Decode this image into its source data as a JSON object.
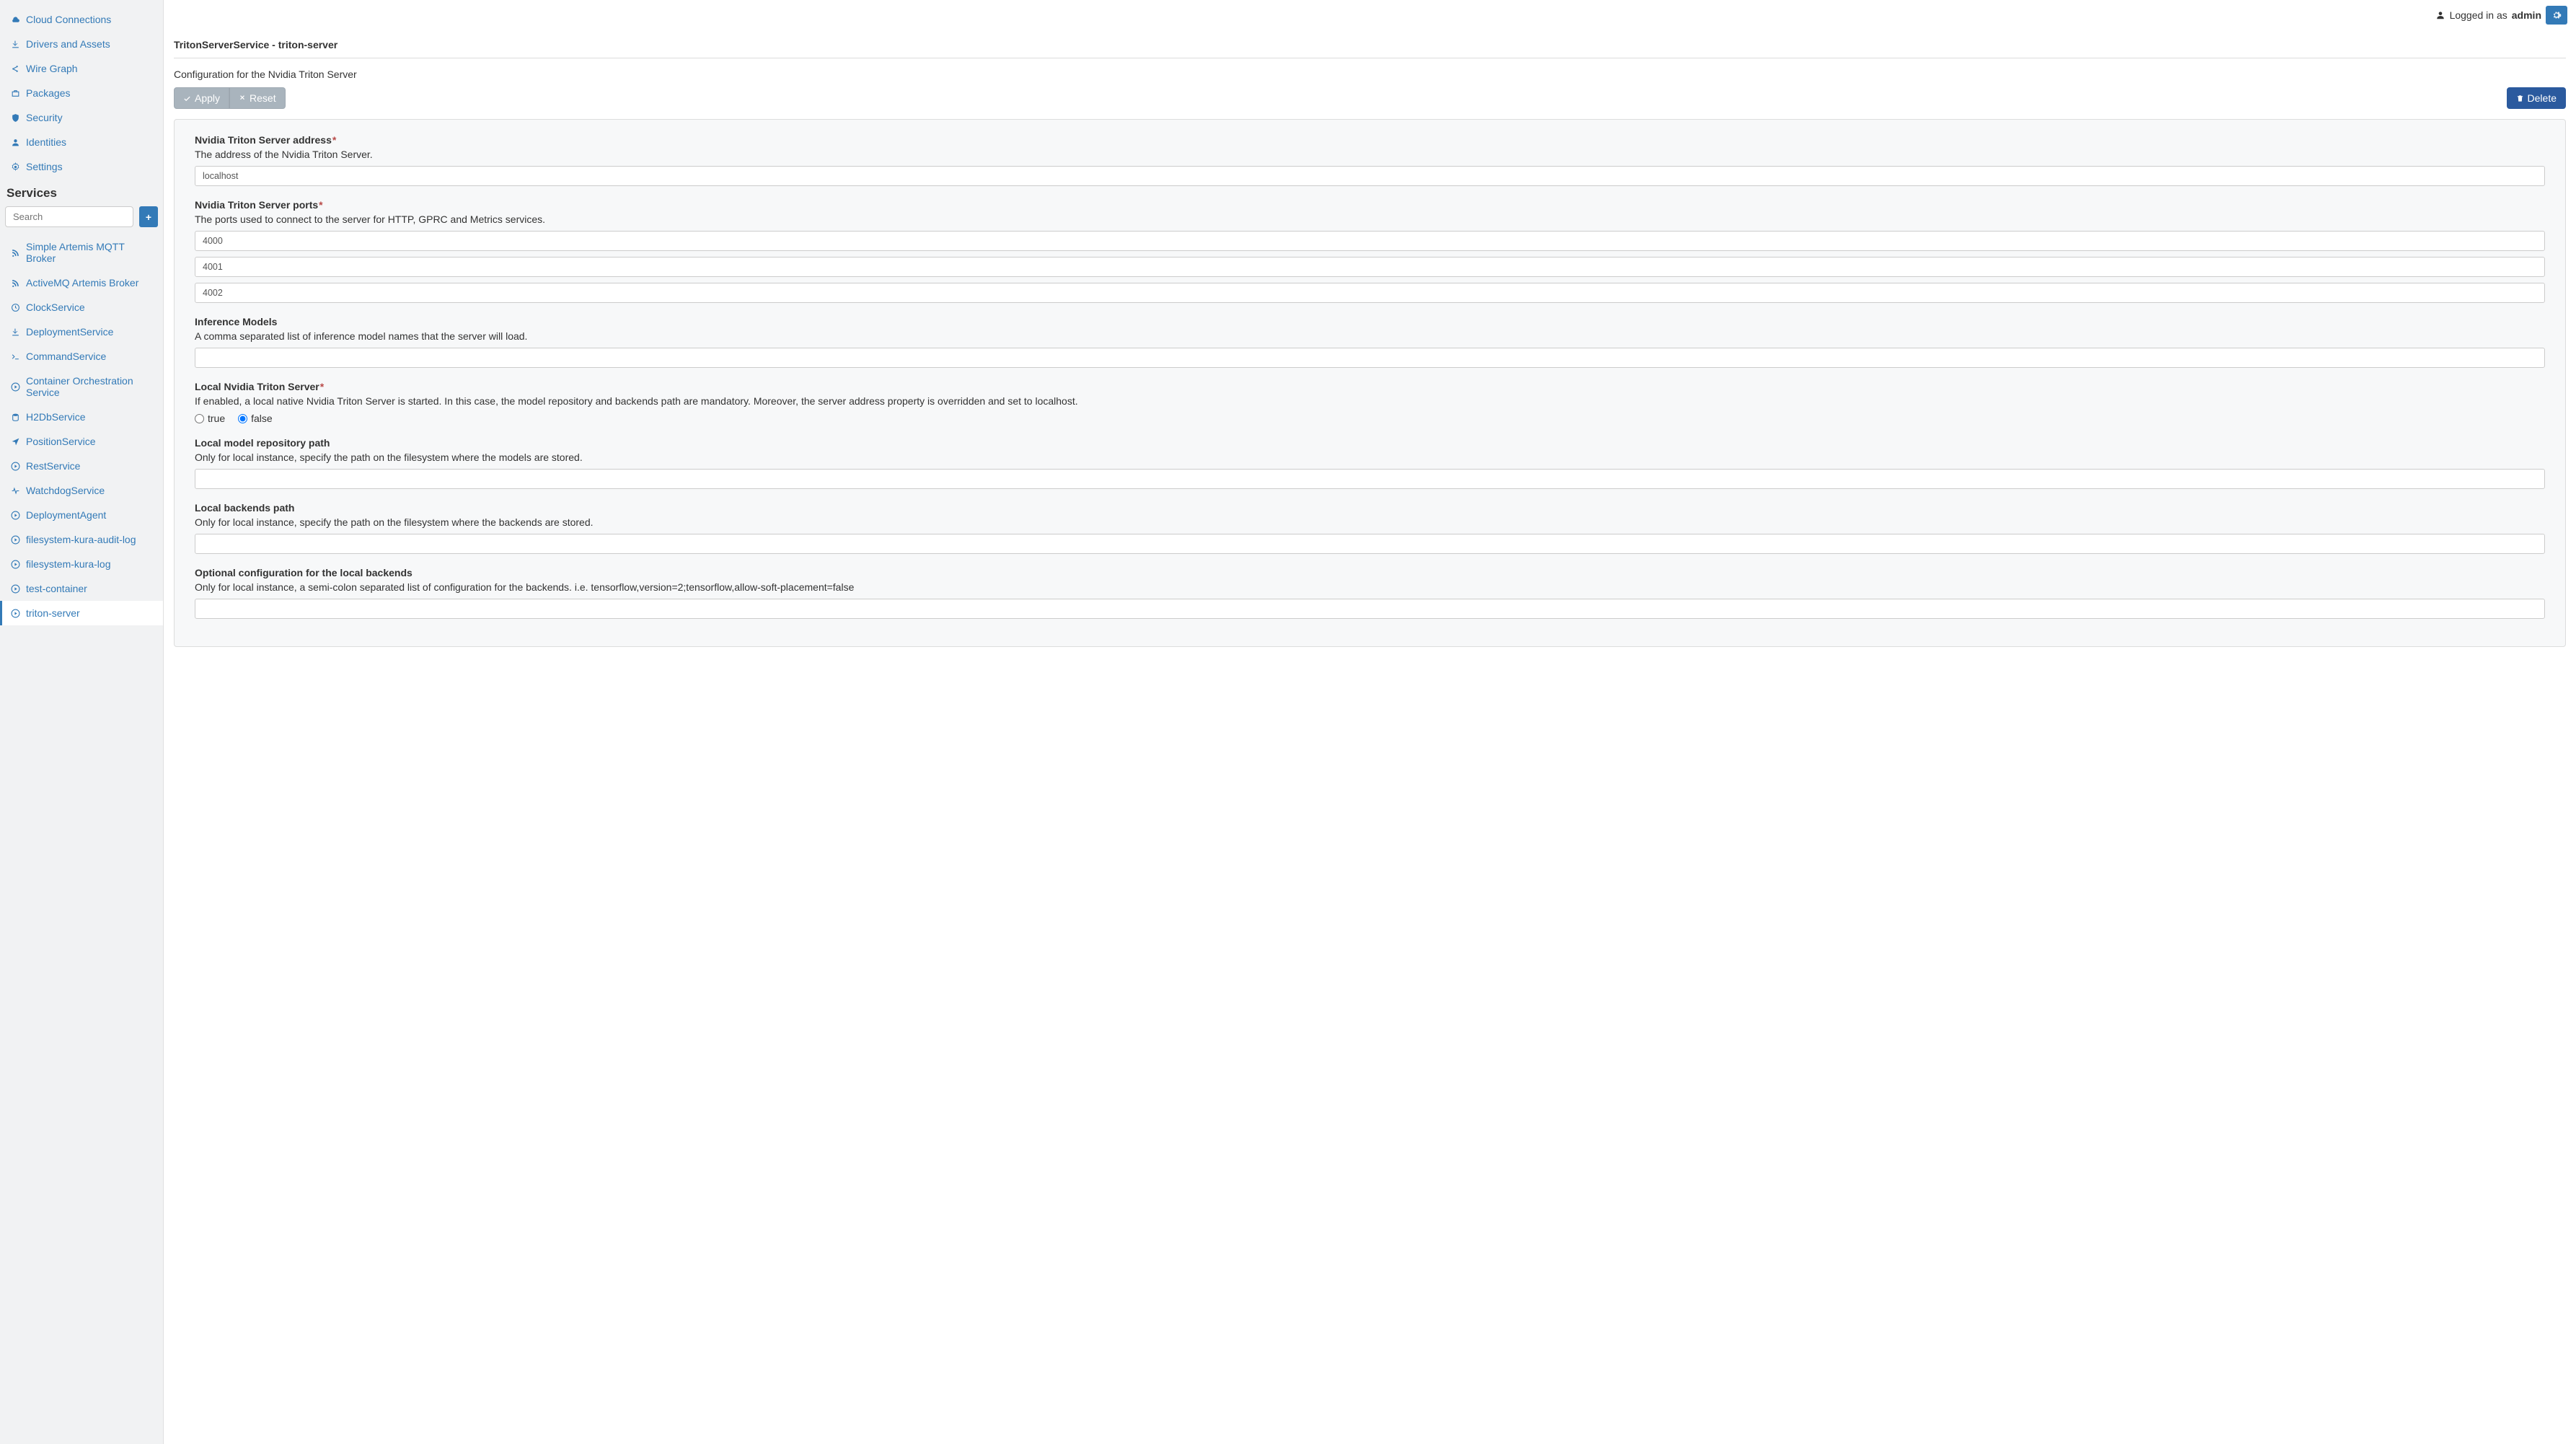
{
  "sidebar": {
    "top": [
      {
        "icon": "cloud",
        "label": "Cloud Connections"
      },
      {
        "icon": "download",
        "label": "Drivers and Assets"
      },
      {
        "icon": "share",
        "label": "Wire Graph"
      },
      {
        "icon": "briefcase",
        "label": "Packages"
      },
      {
        "icon": "shield",
        "label": "Security"
      },
      {
        "icon": "user",
        "label": "Identities"
      },
      {
        "icon": "gear",
        "label": "Settings"
      }
    ],
    "section_heading": "Services",
    "search_placeholder": "Search",
    "services": [
      {
        "icon": "rss",
        "label": "Simple Artemis MQTT Broker"
      },
      {
        "icon": "rss",
        "label": "ActiveMQ Artemis Broker"
      },
      {
        "icon": "clock",
        "label": "ClockService"
      },
      {
        "icon": "download",
        "label": "DeploymentService"
      },
      {
        "icon": "terminal",
        "label": "CommandService"
      },
      {
        "icon": "play",
        "label": "Container Orchestration Service"
      },
      {
        "icon": "db",
        "label": "H2DbService"
      },
      {
        "icon": "location",
        "label": "PositionService"
      },
      {
        "icon": "play",
        "label": "RestService"
      },
      {
        "icon": "heartbeat",
        "label": "WatchdogService"
      },
      {
        "icon": "play",
        "label": "DeploymentAgent"
      },
      {
        "icon": "play",
        "label": "filesystem-kura-audit-log"
      },
      {
        "icon": "play",
        "label": "filesystem-kura-log"
      },
      {
        "icon": "play",
        "label": "test-container"
      },
      {
        "icon": "play",
        "label": "triton-server",
        "active": true
      }
    ]
  },
  "topbar": {
    "logged_in_label": "Logged in as",
    "username": "admin"
  },
  "page": {
    "title": "TritonServerService - triton-server",
    "description": "Configuration for the Nvidia Triton Server",
    "apply_label": "Apply",
    "reset_label": "Reset",
    "delete_label": "Delete"
  },
  "form": {
    "address": {
      "label": "Nvidia Triton Server address",
      "required": true,
      "help": "The address of the Nvidia Triton Server.",
      "value": "localhost"
    },
    "ports": {
      "label": "Nvidia Triton Server ports",
      "required": true,
      "help": "The ports used to connect to the server for HTTP, GPRC and Metrics services.",
      "values": [
        "4000",
        "4001",
        "4002"
      ]
    },
    "models": {
      "label": "Inference Models",
      "required": false,
      "help": "A comma separated list of inference model names that the server will load.",
      "value": ""
    },
    "local": {
      "label": "Local Nvidia Triton Server",
      "required": true,
      "help": "If enabled, a local native Nvidia Triton Server is started. In this case, the model repository and backends path are mandatory. Moreover, the server address property is overridden and set to localhost.",
      "true_label": "true",
      "false_label": "false",
      "value": "false"
    },
    "repo_path": {
      "label": "Local model repository path",
      "required": false,
      "help": "Only for local instance, specify the path on the filesystem where the models are stored.",
      "value": ""
    },
    "backends_path": {
      "label": "Local backends path",
      "required": false,
      "help": "Only for local instance, specify the path on the filesystem where the backends are stored.",
      "value": ""
    },
    "optional_config": {
      "label": "Optional configuration for the local backends",
      "required": false,
      "help": "Only for local instance, a semi-colon separated list of configuration for the backends. i.e. tensorflow,version=2;tensorflow,allow-soft-placement=false",
      "value": ""
    }
  }
}
